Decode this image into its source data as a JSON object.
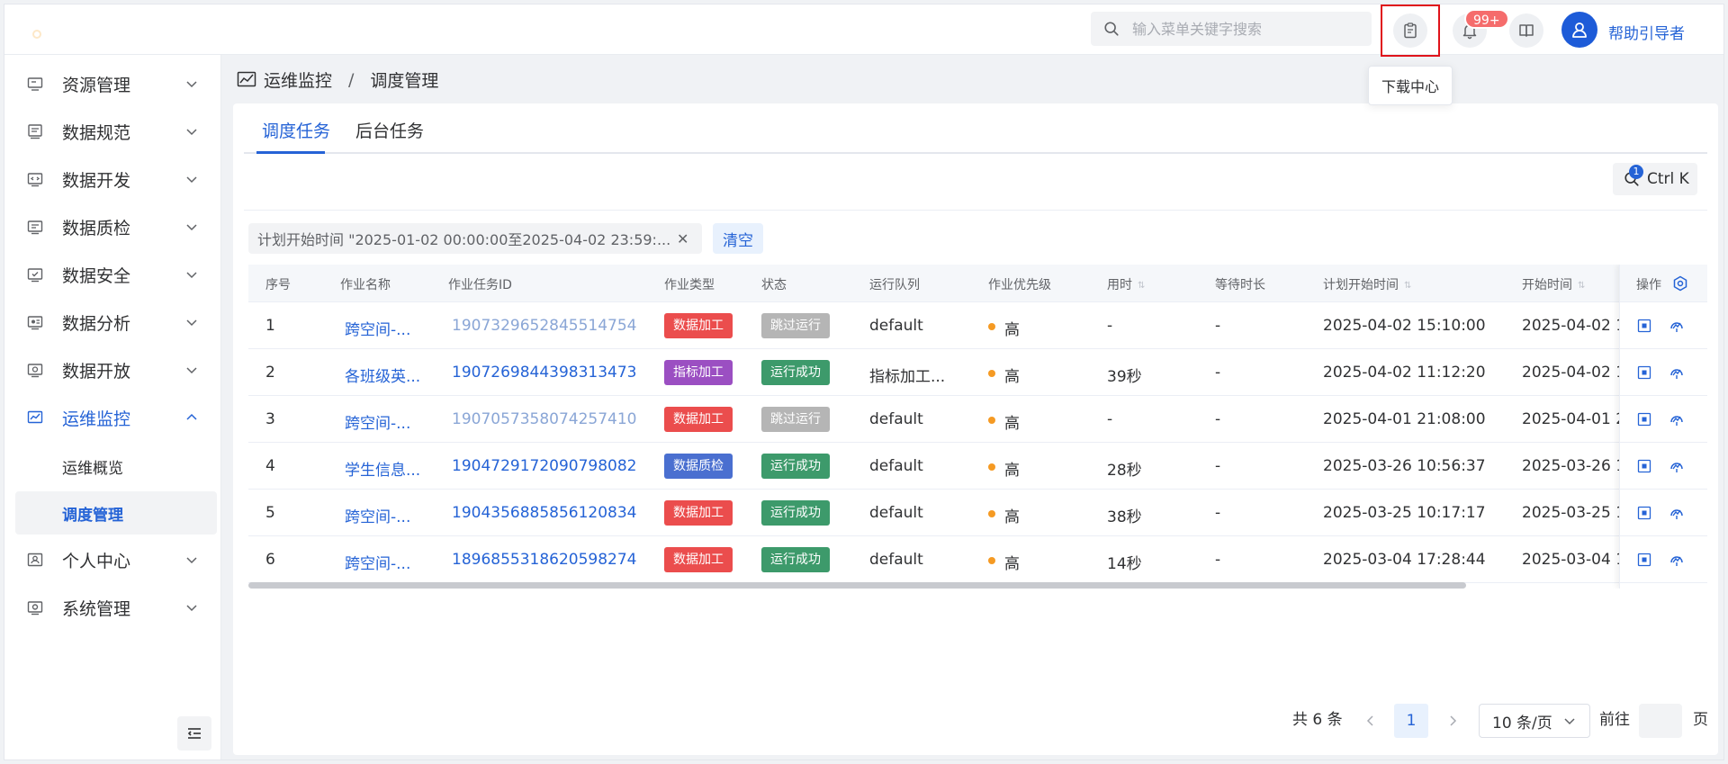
{
  "header": {
    "search_placeholder": "输入菜单关键字搜索",
    "notification_badge": "99+",
    "help_label": "帮助引导者",
    "tooltip": "下载中心"
  },
  "sidebar": {
    "items": [
      {
        "label": "资源管理",
        "icon": "server-icon"
      },
      {
        "label": "数据规范",
        "icon": "document-icon"
      },
      {
        "label": "数据开发",
        "icon": "code-icon"
      },
      {
        "label": "数据质检",
        "icon": "inspect-icon"
      },
      {
        "label": "数据安全",
        "icon": "shield-check-icon"
      },
      {
        "label": "数据分析",
        "icon": "analysis-icon"
      },
      {
        "label": "数据开放",
        "icon": "share-icon"
      },
      {
        "label": "运维监控",
        "icon": "line-chart-icon"
      }
    ],
    "sub_items": [
      {
        "label": "运维概览"
      },
      {
        "label": "调度管理"
      }
    ],
    "items_after": [
      {
        "label": "个人中心",
        "icon": "user-card-icon"
      },
      {
        "label": "系统管理",
        "icon": "settings-icon"
      }
    ]
  },
  "breadcrumb": {
    "first": "运维监控",
    "separator": "/",
    "current": "调度管理"
  },
  "tabs": [
    {
      "label": "调度任务"
    },
    {
      "label": "后台任务"
    }
  ],
  "ctrl_k": {
    "label": "Ctrl K",
    "count": "1"
  },
  "filter": {
    "chip_text": "计划开始时间 \"2025-01-02 00:00:00至2025-04-02 23:59:...",
    "clear_label": "清空"
  },
  "table": {
    "columns": [
      "序号",
      "作业名称",
      "作业任务ID",
      "作业类型",
      "状态",
      "运行队列",
      "作业优先级",
      "用时",
      "等待时长",
      "计划开始时间",
      "开始时间",
      "操作"
    ],
    "rows": [
      {
        "no": "1",
        "name": "跨空间-...",
        "task_id": "1907329652845514754",
        "type": "数据加工",
        "status": "跳过运行",
        "queue": "default",
        "priority": "高",
        "duration": "-",
        "wait": "-",
        "plan_start": "2025-04-02 15:10:00",
        "start": "2025-04-02 1"
      },
      {
        "no": "2",
        "name": "各班级英...",
        "task_id": "1907269844398313473",
        "type": "指标加工",
        "status": "运行成功",
        "queue": "指标加工...",
        "priority": "高",
        "duration": "39秒",
        "wait": "-",
        "plan_start": "2025-04-02 11:12:20",
        "start": "2025-04-02 1"
      },
      {
        "no": "3",
        "name": "跨空间-...",
        "task_id": "1907057358074257410",
        "type": "数据加工",
        "status": "跳过运行",
        "queue": "default",
        "priority": "高",
        "duration": "-",
        "wait": "-",
        "plan_start": "2025-04-01 21:08:00",
        "start": "2025-04-01 2"
      },
      {
        "no": "4",
        "name": "学生信息...",
        "task_id": "1904729172090798082",
        "type": "数据质检",
        "status": "运行成功",
        "queue": "default",
        "priority": "高",
        "duration": "28秒",
        "wait": "-",
        "plan_start": "2025-03-26 10:56:37",
        "start": "2025-03-26 1"
      },
      {
        "no": "5",
        "name": "跨空间-...",
        "task_id": "1904356885856120834",
        "type": "数据加工",
        "status": "运行成功",
        "queue": "default",
        "priority": "高",
        "duration": "38秒",
        "wait": "-",
        "plan_start": "2025-03-25 10:17:17",
        "start": "2025-03-25 1"
      },
      {
        "no": "6",
        "name": "跨空间-...",
        "task_id": "1896855318620598274",
        "type": "数据加工",
        "status": "运行成功",
        "queue": "default",
        "priority": "高",
        "duration": "14秒",
        "wait": "-",
        "plan_start": "2025-03-04 17:28:44",
        "start": "2025-03-04 1"
      }
    ]
  },
  "colors": {
    "accent": "#2563d6",
    "tag_data_process": "#eb4d4d",
    "tag_indicator": "#9b4fc2",
    "tag_quality": "#4a6fd0",
    "status_skip": "#b5b5b5",
    "status_success": "#3d9a6b",
    "priority_high": "#f59a23"
  },
  "pagination": {
    "total": "共 6 条",
    "current_page": "1",
    "page_size": "10 条/页",
    "goto_label": "前往",
    "page_label": "页"
  }
}
